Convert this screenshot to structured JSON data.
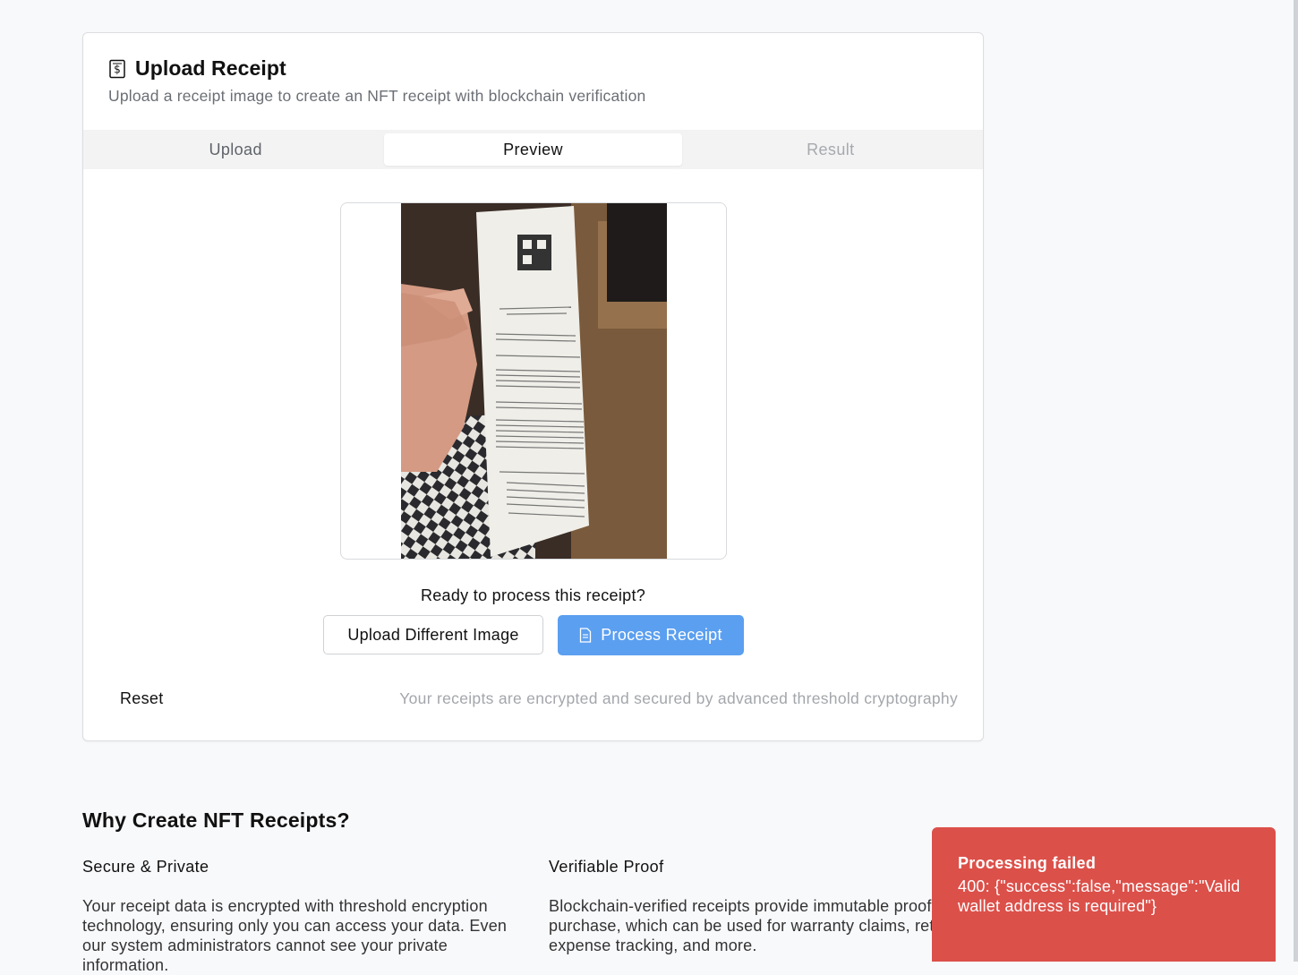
{
  "card": {
    "title": "Upload Receipt",
    "subtitle": "Upload a receipt image to create an NFT receipt with blockchain verification",
    "icon": "receipt-dollar-icon"
  },
  "tabs": [
    {
      "label": "Upload",
      "state": "normal"
    },
    {
      "label": "Preview",
      "state": "active"
    },
    {
      "label": "Result",
      "state": "disabled"
    }
  ],
  "preview": {
    "ready_text": "Ready to process this receipt?",
    "upload_different_label": "Upload Different Image",
    "process_label": "Process Receipt"
  },
  "footer": {
    "reset_label": "Reset",
    "security_note": "Your receipts are encrypted and secured by advanced threshold cryptography"
  },
  "why": {
    "heading": "Why Create NFT Receipts?",
    "features": [
      {
        "title": "Secure & Private",
        "text": "Your receipt data is encrypted with threshold encryption technology, ensuring only you can access your data. Even our system administrators cannot see your private information."
      },
      {
        "title": "Verifiable Proof",
        "text": "Blockchain-verified receipts provide immutable proof of purchase, which can be used for warranty claims, returns, expense tracking, and more."
      }
    ]
  },
  "toast": {
    "title": "Processing failed",
    "message": "400: {\"success\":false,\"message\":\"Valid wallet address is required\"}"
  },
  "colors": {
    "primary": "#5b9ff0",
    "error": "#dc504a",
    "muted_text": "#a3a6ab"
  }
}
